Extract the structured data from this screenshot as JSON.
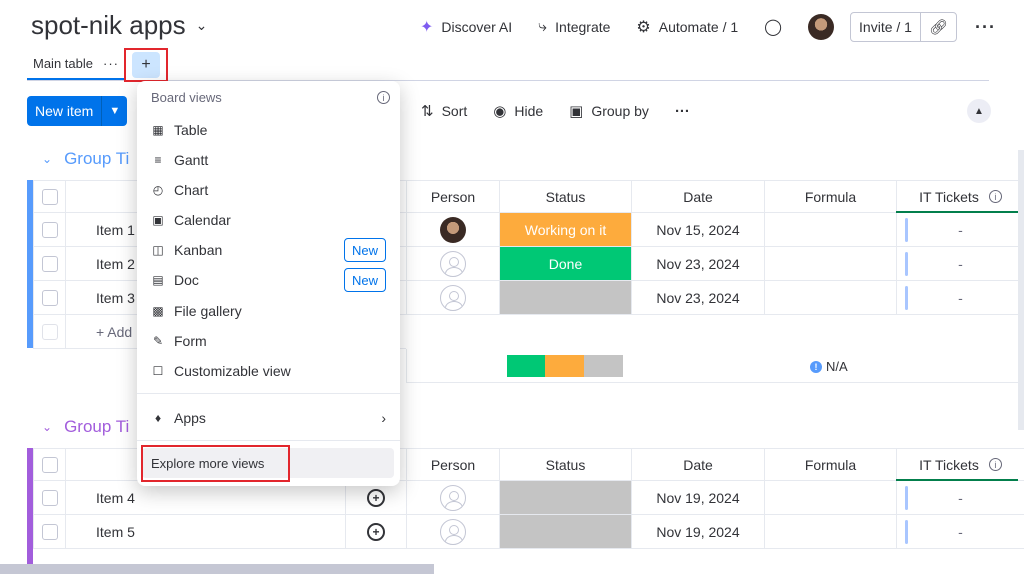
{
  "header": {
    "board_title": "spot-nik apps",
    "actions": [
      {
        "icon": "sparkle-icon",
        "label": "Discover AI"
      },
      {
        "icon": "integrate-icon",
        "label": "Integrate"
      },
      {
        "icon": "robot-icon",
        "label": "Automate / 1"
      }
    ],
    "invite_label": "Invite / 1"
  },
  "tabs": {
    "main_label": "Main table",
    "add_label": "+"
  },
  "toolbar": {
    "new_item_label": "New item",
    "sort_label": "Sort",
    "hide_label": "Hide",
    "group_by_label": "Group by"
  },
  "menu": {
    "heading": "Board views",
    "items": [
      {
        "icon": "table-icon",
        "label": "Table"
      },
      {
        "icon": "gantt-icon",
        "label": "Gantt"
      },
      {
        "icon": "chart-icon",
        "label": "Chart"
      },
      {
        "icon": "calendar-icon",
        "label": "Calendar"
      },
      {
        "icon": "kanban-icon",
        "label": "Kanban",
        "badge": "New"
      },
      {
        "icon": "doc-icon",
        "label": "Doc",
        "badge": "New"
      },
      {
        "icon": "gallery-icon",
        "label": "File gallery"
      },
      {
        "icon": "form-icon",
        "label": "Form"
      },
      {
        "icon": "custom-view-icon",
        "label": "Customizable view"
      }
    ],
    "apps_label": "Apps",
    "explore_label": "Explore more views"
  },
  "groups": [
    {
      "title": "Group Ti",
      "color": "#579bfc",
      "columns": [
        "Person",
        "Status",
        "Date",
        "Formula",
        "IT Tickets"
      ],
      "rows": [
        {
          "name": "Item 1",
          "person": "photo",
          "status": "Working on it",
          "status_color": "#fdab3d",
          "date": "Nov 15, 2024",
          "ticket": "-"
        },
        {
          "name": "Item 2",
          "person": "empty",
          "status": "Done",
          "status_color": "#00c875",
          "date": "Nov 23, 2024",
          "ticket": "-"
        },
        {
          "name": "Item 3",
          "person": "empty",
          "status": "",
          "status_color": "#c4c4c4",
          "date": "Nov 23, 2024",
          "ticket": "-"
        }
      ],
      "add_label": "+ Add",
      "summary_formula": "N/A"
    },
    {
      "title": "Group Ti",
      "color": "#a25ddc",
      "columns": [
        "Person",
        "Status",
        "Date",
        "Formula",
        "IT Tickets"
      ],
      "rows": [
        {
          "name": "Item 4",
          "person": "empty",
          "status": "",
          "status_color": "#c4c4c4",
          "date": "Nov 19, 2024",
          "ticket": "-"
        },
        {
          "name": "Item 5",
          "person": "empty",
          "status": "",
          "status_color": "#c4c4c4",
          "date": "Nov 19, 2024",
          "ticket": "-"
        }
      ]
    }
  ],
  "colors": {
    "primary": "#0073ea",
    "highlight_box": "#e2262d",
    "working": "#fdab3d",
    "done": "#00c875",
    "empty_status": "#c4c4c4",
    "it_tickets_line": "#037f4c"
  }
}
